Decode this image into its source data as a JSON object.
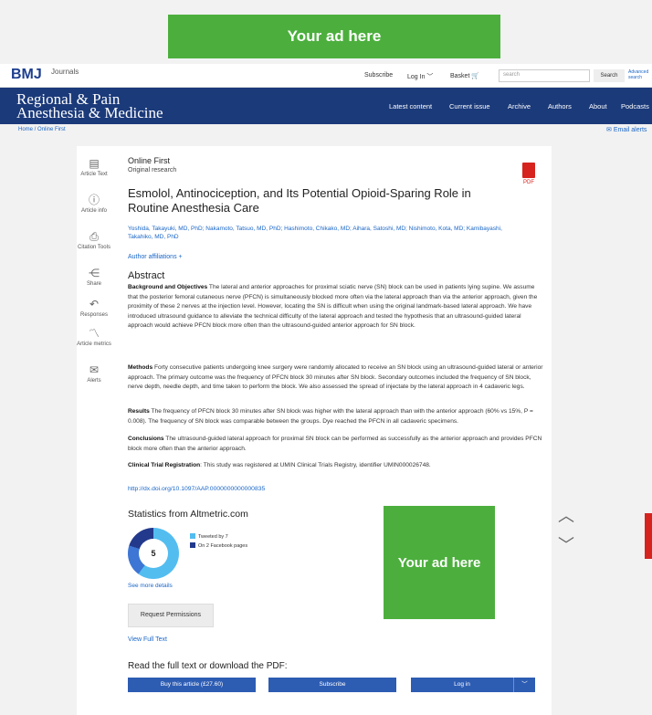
{
  "ads": {
    "top_label": "Your ad here",
    "side_label": "Your ad here"
  },
  "util": {
    "logo": "BMJ",
    "logo_sub": "Journals",
    "subscribe": "Subscribe",
    "login": "Log In",
    "basket": "Basket",
    "search_placeholder": "search",
    "search_btn": "Search",
    "advanced": "Advanced search"
  },
  "journal": {
    "title_line1": "Regional & Pain",
    "title_line2": "Anesthesia & Medicine",
    "nav": [
      "Latest content",
      "Current issue",
      "Archive",
      "Authors",
      "About",
      "Podcasts"
    ]
  },
  "crumb": {
    "path": "Home / Online First",
    "email_alerts": "Email alerts"
  },
  "tools": [
    {
      "label": "Article Text"
    },
    {
      "label": "Article info"
    },
    {
      "label": "Citation Tools"
    },
    {
      "label": "Share"
    },
    {
      "label": "Responses"
    },
    {
      "label": "Article metrics"
    },
    {
      "label": "Alerts"
    }
  ],
  "article": {
    "section": "Online First",
    "type": "Original research",
    "pdf": "PDF",
    "title": "Esmolol, Antinociception, and Its Potential Opioid-Sparing Role in Routine Anesthesia Care",
    "authors": "Yoshida, Takayuki, MD, PhD; Nakamoto, Tatsuo, MD, PhD; Hashimoto, Chikako, MD; Aihara, Satoshi, MD; Nishimoto, Kota, MD; Kamibayashi, Takahiko, MD, PhD",
    "affiliations": "Author affiliations +",
    "abstract_heading": "Abstract",
    "bg_label": "Background and Objectives",
    "bg_text": " The lateral and anterior approaches for proximal sciatic nerve (SN) block can be used in patients lying supine. We assume that the posterior femoral cutaneous nerve (PFCN) is simultaneously blocked more often via the lateral approach than via the anterior approach, given the proximity of these 2 nerves at the injection level. However, locating the SN is difficult when using the original landmark-based lateral approach. We have introduced ultrasound guidance to alleviate the technical difficulty of the lateral approach and tested the hypothesis that an ultrasound-guided lateral approach would achieve PFCN block more often than the ultrasound-guided anterior approach for SN block.",
    "methods_label": "Methods",
    "methods_text": " Forty consecutive patients undergoing knee surgery were randomly allocated to receive an SN block using an ultrasound-guided lateral or anterior approach. The primary outcome was the frequency of PFCN block 30 minutes after SN block. Secondary outcomes included the frequency of SN block, nerve depth, needle depth, and time taken to perform the block. We also assessed the spread of injectate by the lateral approach in 4 cadaveric legs.",
    "results_label": "Results",
    "results_text": " The frequency of PFCN block 30 minutes after SN block was higher with the lateral approach than with the anterior approach (60% vs 15%, P = 0.008). The frequency of SN block was comparable between the groups. Dye reached the PFCN in all cadaveric specimens.",
    "conclusions_label": "Conclusions",
    "conclusions_text": " The ultrasound-guided lateral approach for proximal SN block can be performed as successfully as the anterior approach and provides PFCN block more often than the anterior approach.",
    "trial_label": "Clinical Trial Registration",
    "trial_text": ": This study was registered at UMIN Clinical Trials Registry, identifier UMIN000026748.",
    "doi": "http://dx.doi.org/10.1097/AAP.0000000000000835"
  },
  "altmetric": {
    "heading": "Statistics from Altmetric.com",
    "score": "5",
    "legend": [
      {
        "text": "Tweeted by 7",
        "color": "#53bdf0"
      },
      {
        "text": "On 2 Facebook pages",
        "color": "#22398c"
      }
    ],
    "more": "See more details"
  },
  "actions": {
    "request_permissions": "Request Permissions",
    "view_full_text": "View Full Text",
    "read_heading": "Read the full text or download the PDF:",
    "buy": "Buy this article (£27.60)",
    "subscribe": "Subscribe",
    "login": "Log in"
  },
  "colors": {
    "brand_blue": "#1b3a7a",
    "link": "#1a66c7",
    "ad_green": "#4caf3d",
    "button_blue": "#2d5cb3"
  }
}
